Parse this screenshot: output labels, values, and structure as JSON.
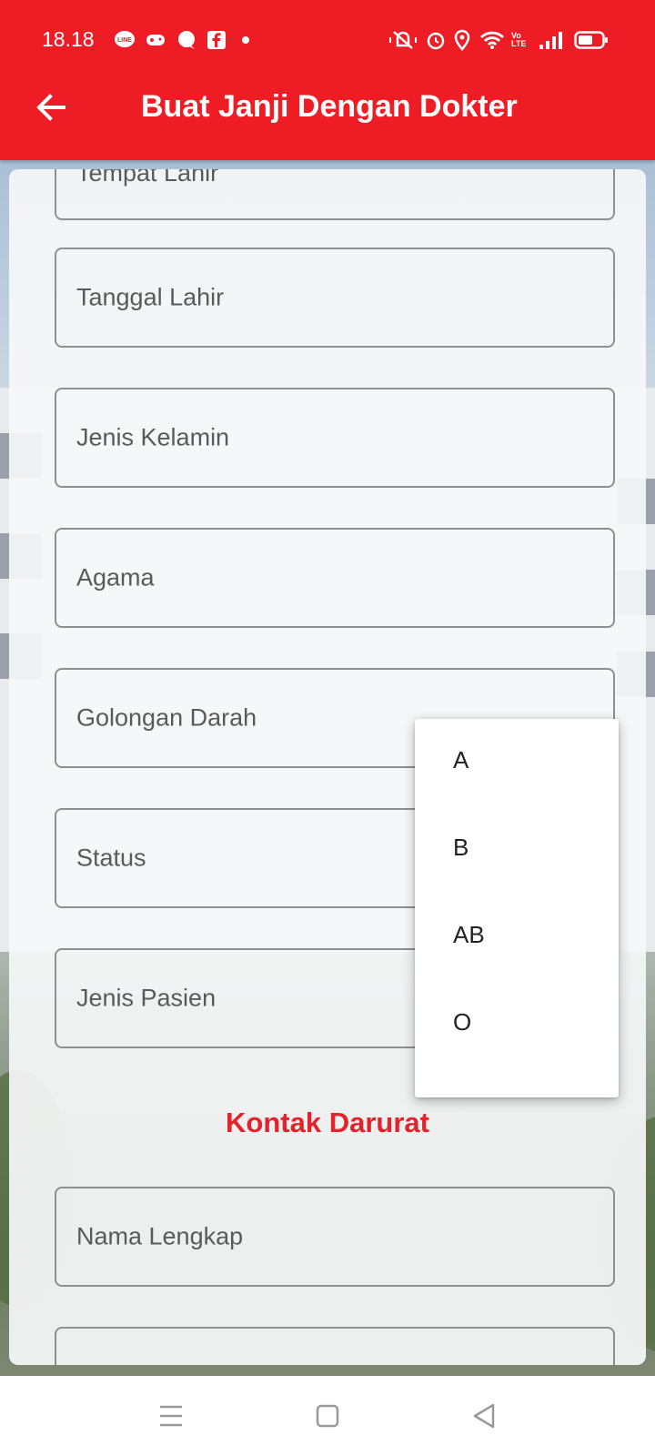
{
  "status_bar": {
    "time": "18.18",
    "vo_lte": "Vo LTE"
  },
  "app_bar": {
    "title": "Buat Janji Dengan Dokter",
    "color": "#ee1c25"
  },
  "form": {
    "fields": [
      "Tempat Lahir",
      "Tanggal Lahir",
      "Jenis Kelamin",
      "Agama",
      "Golongan Darah",
      "Status",
      "Jenis Pasien"
    ],
    "section_title": "Kontak Darurat",
    "emergency_fields": [
      "Nama Lengkap"
    ]
  },
  "dropdown": {
    "options": [
      "A",
      "B",
      "AB",
      "O"
    ]
  },
  "icons": {
    "back": "arrow-left-icon",
    "nav": [
      "menu-icon",
      "home-square-icon",
      "back-triangle-icon"
    ]
  }
}
